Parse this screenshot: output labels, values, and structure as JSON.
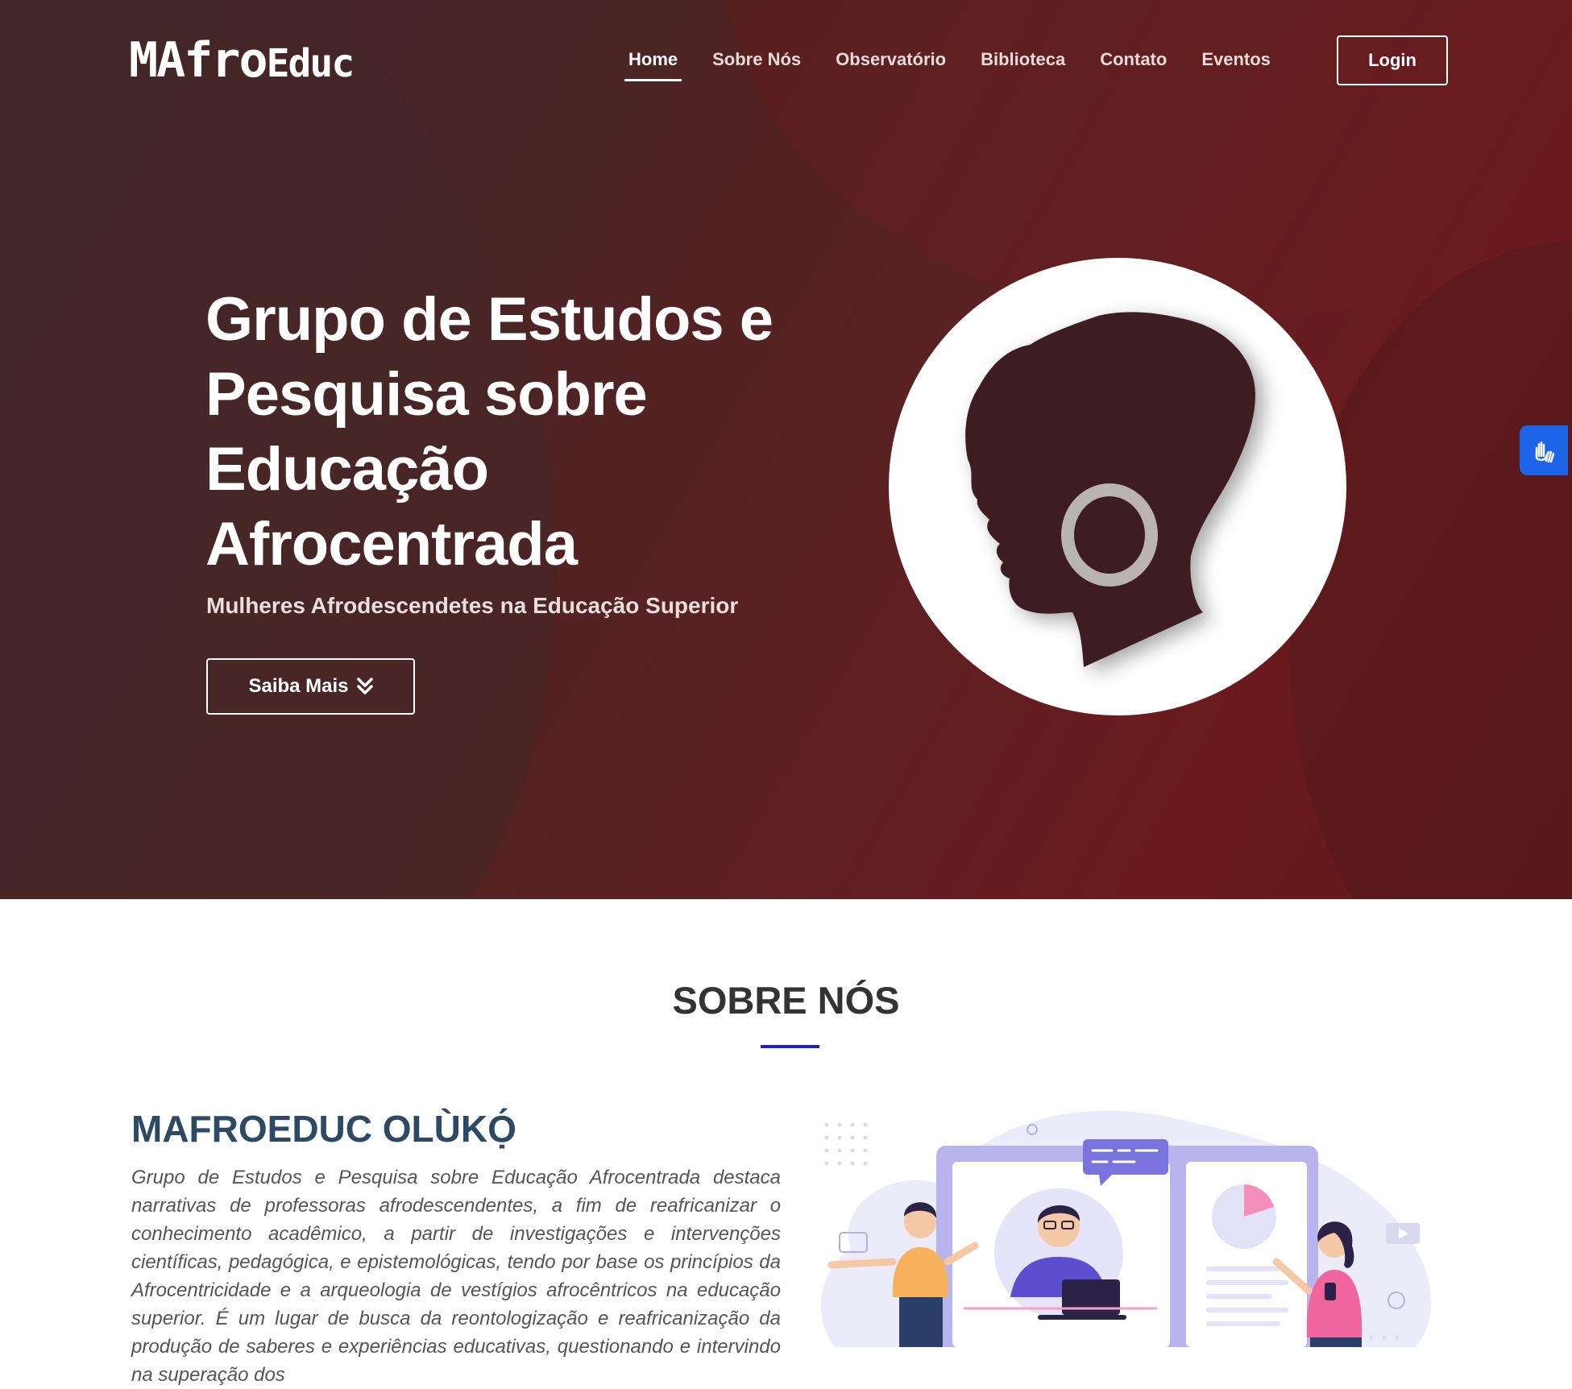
{
  "header": {
    "logo_main": "MAfro",
    "logo_suffix": "Educ",
    "nav": [
      {
        "label": "Home",
        "active": true
      },
      {
        "label": "Sobre Nós",
        "active": false
      },
      {
        "label": "Observatório",
        "active": false
      },
      {
        "label": "Biblioteca",
        "active": false
      },
      {
        "label": "Contato",
        "active": false
      },
      {
        "label": "Eventos",
        "active": false
      }
    ],
    "login_label": "Login"
  },
  "hero": {
    "title": "Grupo de Estudos e Pesquisa sobre Educação Afrocentrada",
    "subtitle": "Mulheres Afrodescendetes na Educação Superior",
    "cta_label": "Saiba Mais",
    "cta_icon": "double-chevron-down-icon",
    "image_icon": "woman-silhouette-profile"
  },
  "accessibility": {
    "icon": "sign-language-hands-icon",
    "color": "#1c64e8"
  },
  "about": {
    "section_title": "SOBRE NÓS",
    "title": "MAFROEDUC OLÙKỌ́",
    "text": "Grupo de Estudos e Pesquisa sobre Educação Afrocentrada destaca narrativas de professoras afrodescendentes, a fim de reafricanizar o conhecimento acadêmico, a partir de investigações e intervenções científicas, pedagógica, e epistemológicas, tendo por base os princípios da Afrocentricidade e a arqueologia de vestígios afrocêntricos na educação superior. É um lugar de busca da reontologização e reafricanização da produção de saberes e experiências educativas, questionando e intervindo na superação dos",
    "illustration": "online-meeting-illustration"
  },
  "colors": {
    "hero_dark": "#3d2526",
    "hero_red": "#6b1a1c",
    "silhouette": "#3e1f21",
    "underline_accent": "#1a1fd4",
    "about_title": "#2c4a63",
    "illustration_purple": "#8b87e0"
  }
}
